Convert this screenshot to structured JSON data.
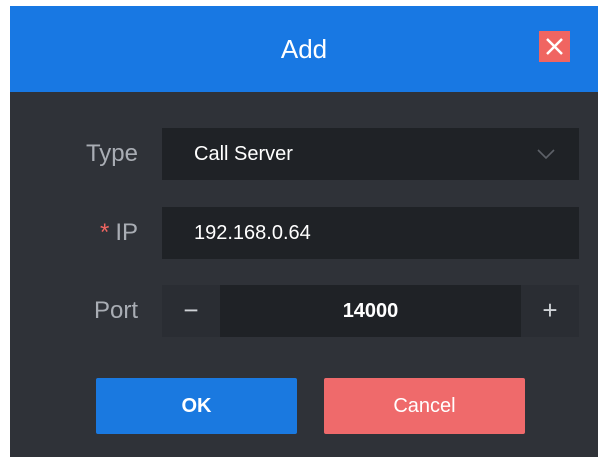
{
  "dialog": {
    "title": "Add",
    "close_icon": "close-icon",
    "colors": {
      "header": "#1878e3",
      "body": "#2f3238",
      "field": "#1f2226",
      "close": "#f06561",
      "ok": "#1a79e0",
      "cancel": "#ef6a6b"
    }
  },
  "form": {
    "type": {
      "label": "Type",
      "value": "Call Server",
      "icon": "chevron-down-icon"
    },
    "ip": {
      "required_mark": "*",
      "label": "IP",
      "value": "192.168.0.64"
    },
    "port": {
      "label": "Port",
      "decrement": "−",
      "increment": "+",
      "value": "14000"
    }
  },
  "actions": {
    "ok_label": "OK",
    "cancel_label": "Cancel"
  }
}
